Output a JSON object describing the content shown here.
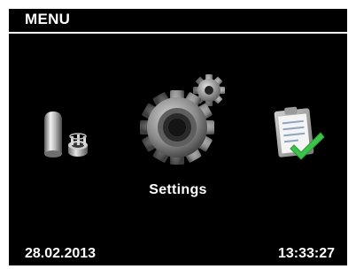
{
  "header": {
    "title": "MENU"
  },
  "menu": {
    "items": [
      {
        "icon": "connector-parts-icon"
      },
      {
        "icon": "settings-gears-icon",
        "label": "Settings",
        "selected": true
      },
      {
        "icon": "checklist-icon"
      }
    ],
    "selected_label": "Settings"
  },
  "status": {
    "date": "28.02.2013",
    "time": "13:33:27"
  },
  "colors": {
    "background": "#000000",
    "text": "#ffffff",
    "check_green": "#3cc24a"
  }
}
